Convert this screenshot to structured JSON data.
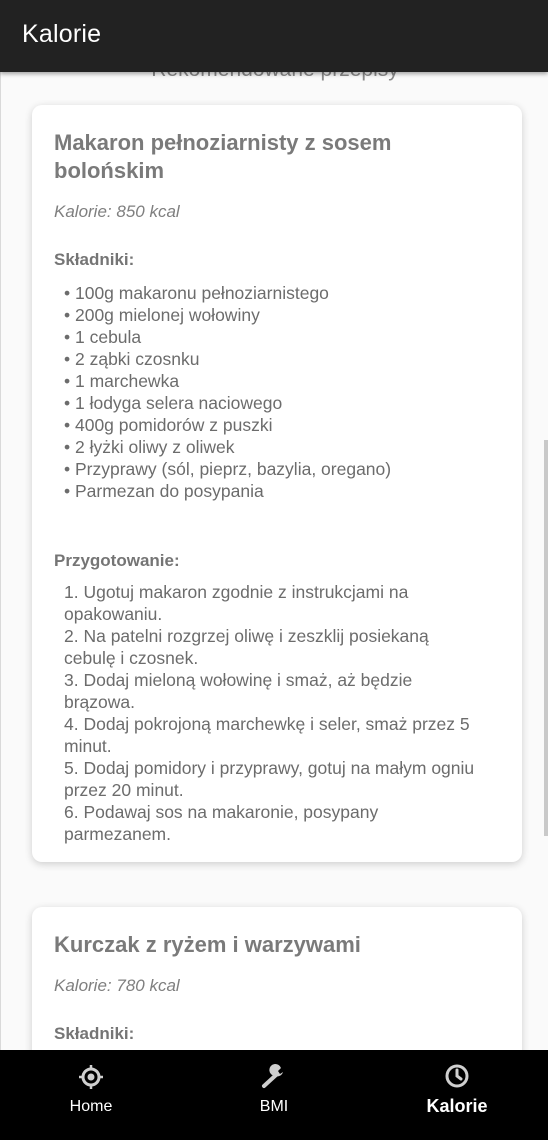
{
  "appbar": {
    "title": "Kalorie"
  },
  "section_title": "Rekomendowane przepisy",
  "recipes": [
    {
      "title": "Makaron pełnoziarnisty z sosem bolońskim",
      "calories": "Kalorie: 850 kcal",
      "ingredients_label": "Składniki:",
      "ingredients": [
        "• 100g makaronu pełnoziarnistego",
        "• 200g mielonej wołowiny",
        "• 1 cebula",
        "• 2 ząbki czosnku",
        "• 1 marchewka",
        "• 1 łodyga selera naciowego",
        "• 400g pomidorów z puszki",
        "• 2 łyżki oliwy z oliwek",
        "• Przyprawy (sól, pieprz, bazylia, oregano)",
        "• Parmezan do posypania"
      ],
      "steps_label": "Przygotowanie:",
      "steps": [
        "1. Ugotuj makaron zgodnie z instrukcjami na opakowaniu.",
        "2. Na patelni rozgrzej oliwę i zeszklij posiekaną cebulę i czosnek.",
        "3. Dodaj mieloną wołowinę i smaż, aż będzie brązowa.",
        "4. Dodaj pokrojoną marchewkę i seler, smaż przez 5 minut.",
        "5. Dodaj pomidory i przyprawy, gotuj na małym ogniu przez 20 minut.",
        "6. Podawaj sos na makaronie, posypany parmezanem."
      ]
    },
    {
      "title": "Kurczak z ryżem i warzywami",
      "calories": "Kalorie: 780 kcal",
      "ingredients_label": "Składniki:"
    }
  ],
  "bottom_nav": {
    "items": [
      {
        "label": "Home",
        "icon": "crosshair-icon"
      },
      {
        "label": "BMI",
        "icon": "wrench-icon"
      },
      {
        "label": "Kalorie",
        "icon": "clock-icon"
      }
    ],
    "active": "Kalorie"
  },
  "colors": {
    "appbar_bg": "#222222",
    "bottom_nav_bg": "#000000",
    "card_bg": "#ffffff",
    "title_text": "#7a7a7a"
  }
}
